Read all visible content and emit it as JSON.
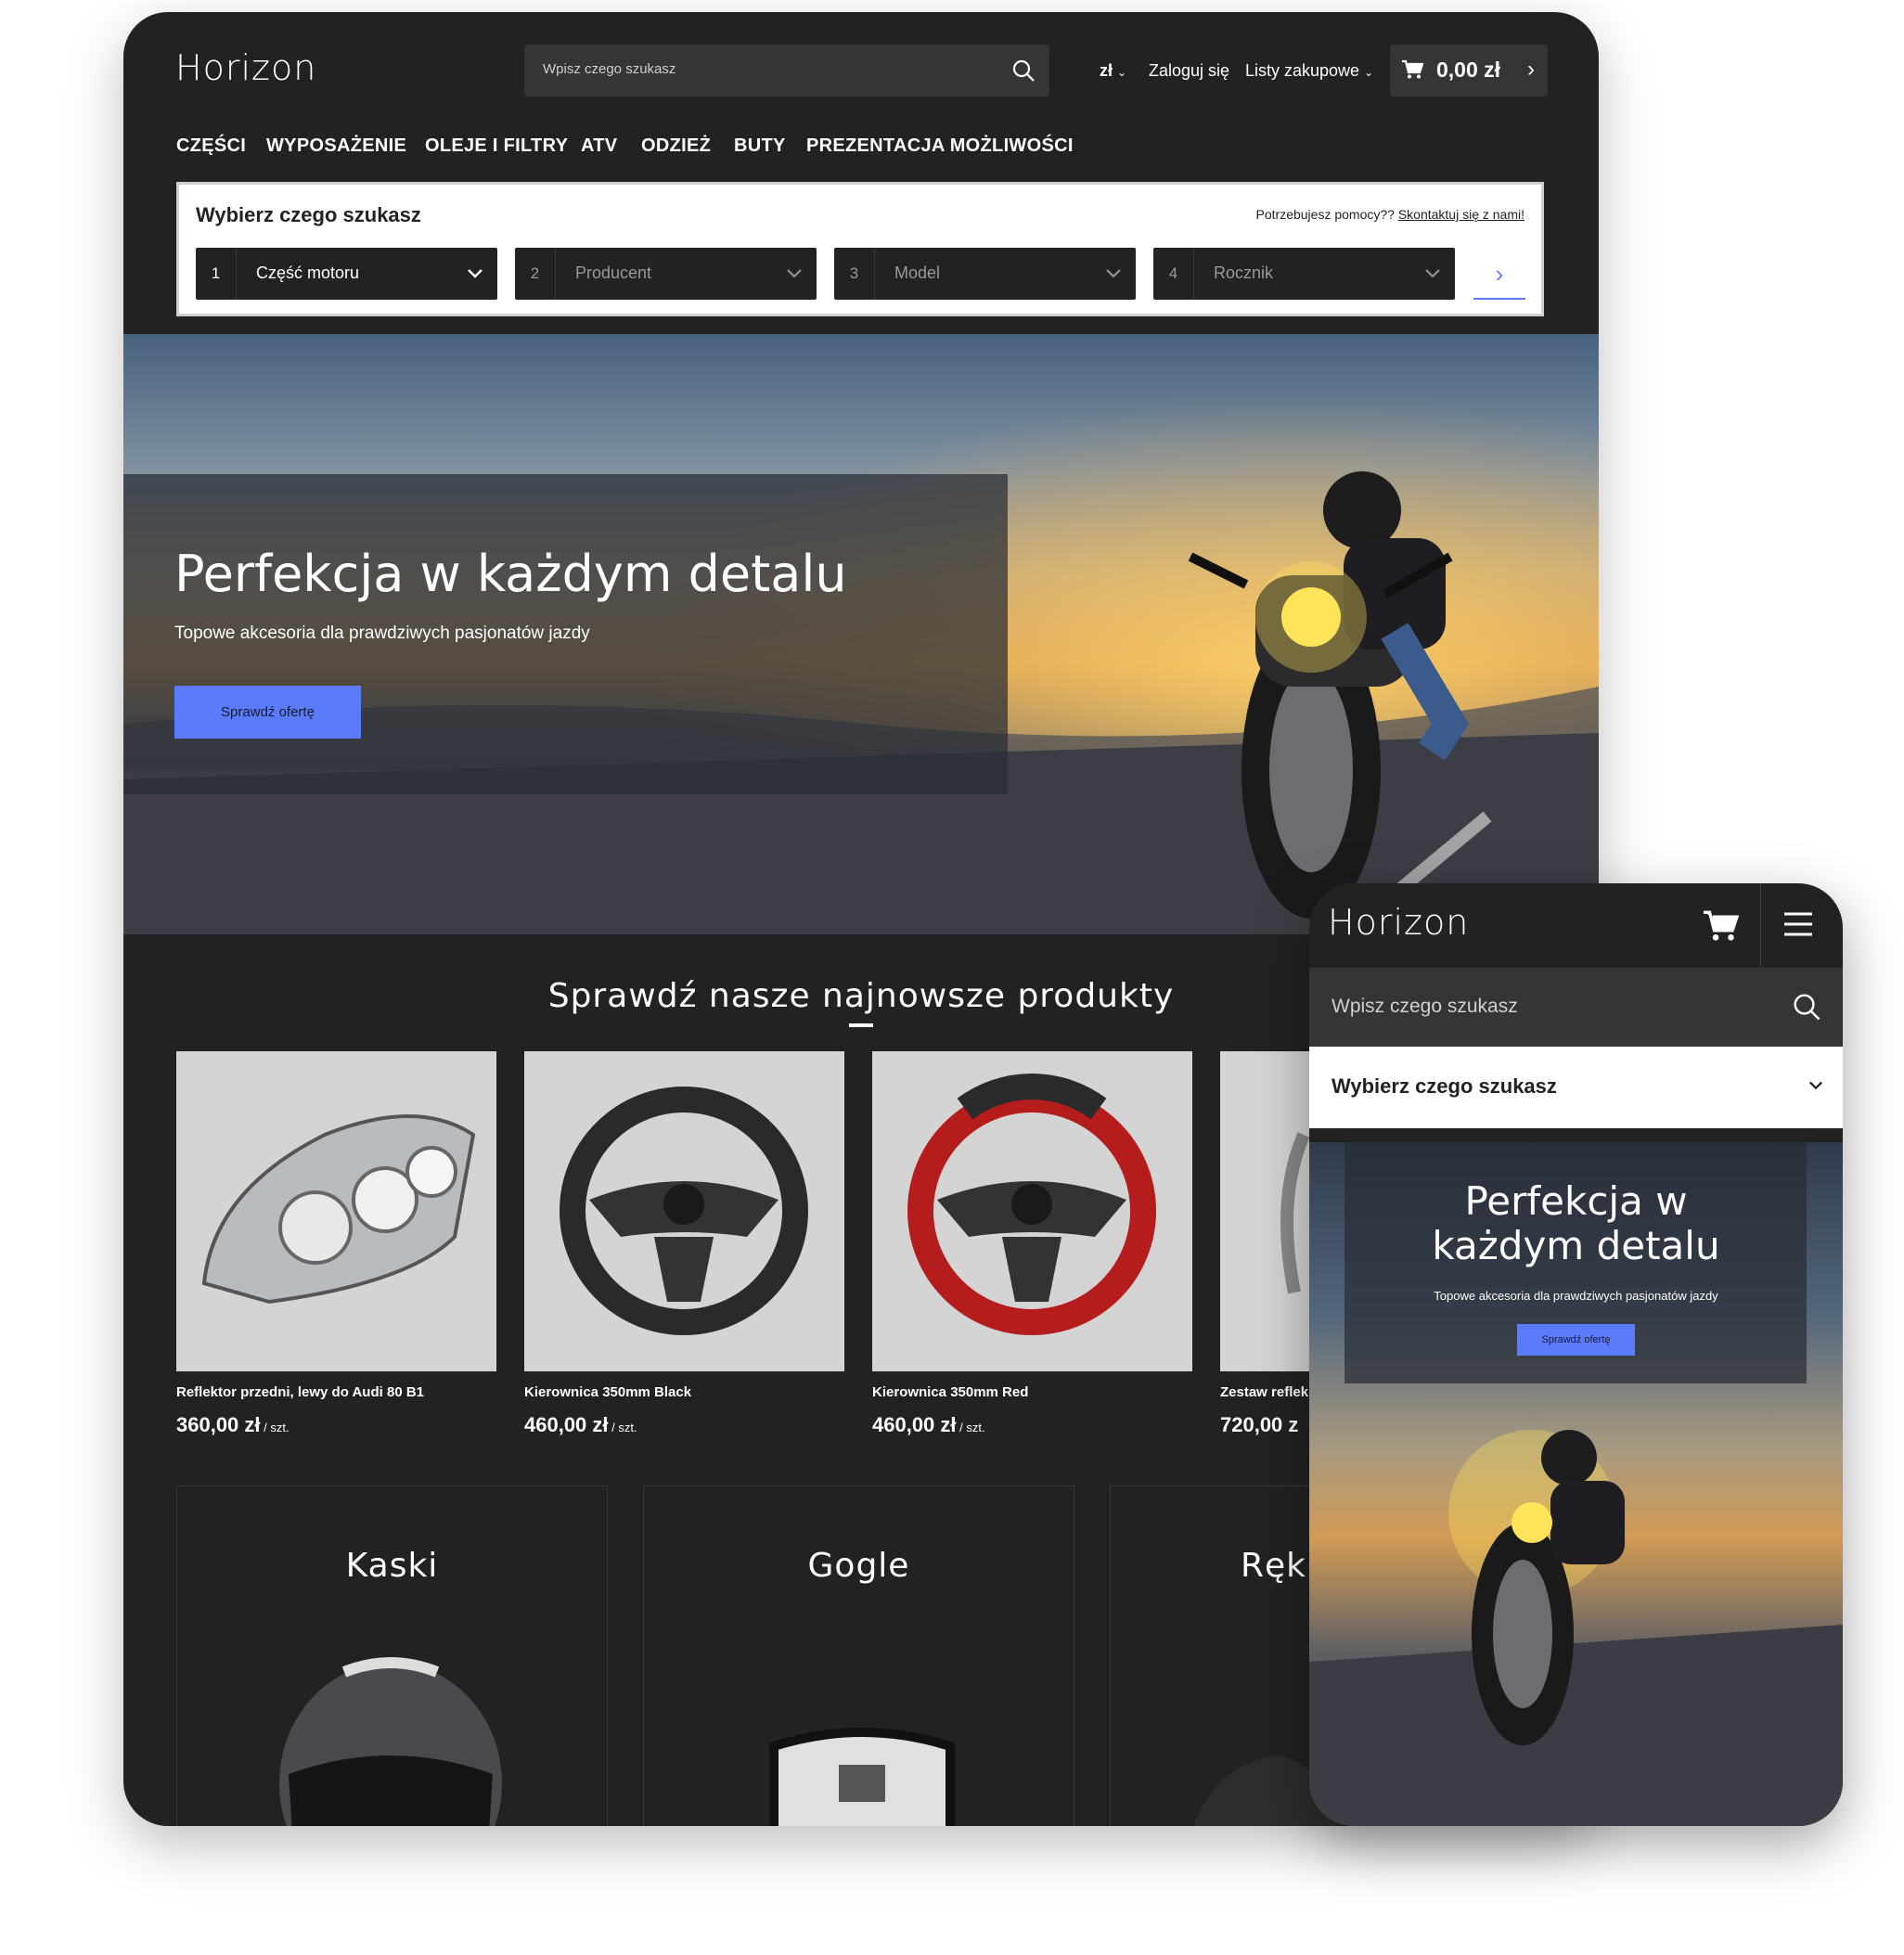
{
  "desktop": {
    "logo": "Horizon",
    "search": {
      "placeholder": "Wpisz czego szukasz"
    },
    "header": {
      "currency": "zł",
      "login": "Zaloguj się",
      "shopping_lists": "Listy zakupowe",
      "cart_total": "0,00 zł"
    },
    "nav": [
      "CZĘŚCI",
      "WYPOSAŻENIE",
      "OLEJE I FILTRY",
      "ATV",
      "ODZIEŻ",
      "BUTY",
      "PREZENTACJA MOŻLIWOŚCI"
    ],
    "finder": {
      "title": "Wybierz czego szukasz",
      "help_text": "Potrzebujesz pomocy??",
      "help_link": "Skontaktuj się z nami!",
      "selects": [
        {
          "num": "1",
          "label": "Część motoru"
        },
        {
          "num": "2",
          "label": "Producent"
        },
        {
          "num": "3",
          "label": "Model"
        },
        {
          "num": "4",
          "label": "Rocznik"
        }
      ]
    },
    "hero": {
      "title": "Perfekcja w każdym detalu",
      "subtitle": "Topowe akcesoria dla prawdziwych pasjonatów jazdy",
      "cta": "Sprawdź ofertę"
    },
    "products_heading": "Sprawdź nasze najnowsze produkty",
    "products": [
      {
        "name": "Reflektor przedni, lewy do Audi 80 B1",
        "price": "360,00 zł",
        "unit": " / szt."
      },
      {
        "name": "Kierownica 350mm Black",
        "price": "460,00 zł",
        "unit": " / szt."
      },
      {
        "name": "Kierownica 350mm Red",
        "price": "460,00 zł",
        "unit": " / szt."
      },
      {
        "name": "Zestaw reflek",
        "price": "720,00 z",
        "unit": ""
      }
    ],
    "categories": [
      "Kaski",
      "Gogle",
      "Ręk"
    ]
  },
  "mobile": {
    "logo": "Horizon",
    "search": {
      "placeholder": "Wpisz czego szukasz"
    },
    "finder_title": "Wybierz czego szukasz",
    "hero": {
      "title_line1": "Perfekcja w",
      "title_line2": "każdym detalu",
      "subtitle": "Topowe akcesoria dla prawdziwych pasjonatów jazdy",
      "cta": "Sprawdź ofertę"
    }
  },
  "colors": {
    "accent": "#5b7cfa",
    "dark": "#222222",
    "panel": "#353535"
  }
}
